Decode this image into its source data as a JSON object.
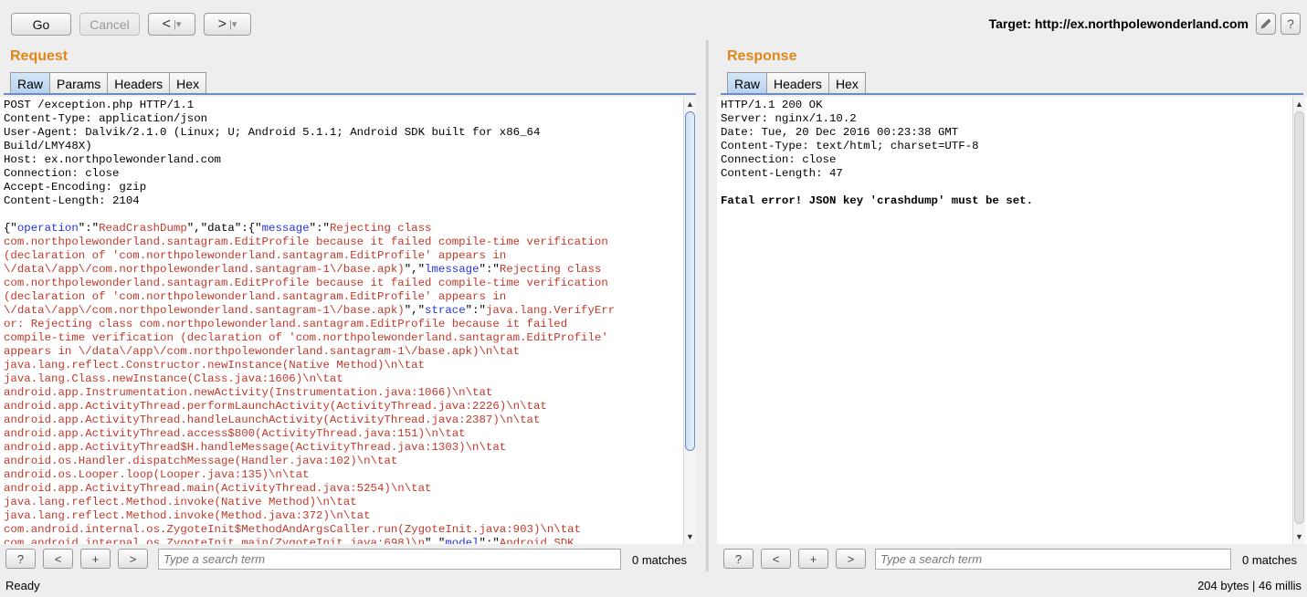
{
  "toolbar": {
    "go_label": "Go",
    "cancel_label": "Cancel",
    "back_glyph": "<",
    "forward_glyph": ">",
    "dropdown_glyph": "▾",
    "target_text": "Target: http://ex.northpolewonderland.com",
    "edit_icon": "pencil-icon",
    "help_glyph": "?"
  },
  "request": {
    "title": "Request",
    "tabs": [
      "Raw",
      "Params",
      "Headers",
      "Hex"
    ],
    "active_tab": "Raw",
    "headers": [
      "POST /exception.php HTTP/1.1",
      "Content-Type: application/json",
      "User-Agent: Dalvik/2.1.0 (Linux; U; Android 5.1.1; Android SDK built for x86_64",
      "Build/LMY48X)",
      "Host: ex.northpolewonderland.com",
      "Connection: close",
      "Accept-Encoding: gzip",
      "Content-Length: 2104"
    ],
    "body": {
      "l1_a": "{\"",
      "l1_key_operation": "operation",
      "l1_b": "\":\"",
      "l1_val_operation": "ReadCrashDump",
      "l1_c": "\",\"data\":{\"",
      "l1_key_message": "message",
      "l1_d": "\":\"",
      "l1_val": "Rejecting class",
      "l2": "com.northpolewonderland.santagram.EditProfile because it failed compile-time verification",
      "l3": "(declaration of 'com.northpolewonderland.santagram.EditProfile' appears in",
      "l4_val": "\\/data\\/app\\/com.northpolewonderland.santagram-1\\/base.apk)",
      "l4_a": "\",\"",
      "l4_key": "lmessage",
      "l4_b": "\":\"",
      "l4_val2": "Rejecting class",
      "l5": "com.northpolewonderland.santagram.EditProfile because it failed compile-time verification",
      "l6": "(declaration of 'com.northpolewonderland.santagram.EditProfile' appears in",
      "l7_val": "\\/data\\/app\\/com.northpolewonderland.santagram-1\\/base.apk)",
      "l7_a": "\",\"",
      "l7_key": "strace",
      "l7_b": "\":\"",
      "l7_val2": "java.lang.VerifyErr",
      "l8": "or: Rejecting class com.northpolewonderland.santagram.EditProfile because it failed",
      "l9": "compile-time verification (declaration of 'com.northpolewonderland.santagram.EditProfile'",
      "l10": "appears in \\/data\\/app\\/com.northpolewonderland.santagram-1\\/base.apk)\\n\\tat",
      "l11": "java.lang.reflect.Constructor.newInstance(Native Method)\\n\\tat",
      "l12": "java.lang.Class.newInstance(Class.java:1606)\\n\\tat",
      "l13": "android.app.Instrumentation.newActivity(Instrumentation.java:1066)\\n\\tat",
      "l14": "android.app.ActivityThread.performLaunchActivity(ActivityThread.java:2226)\\n\\tat",
      "l15": "android.app.ActivityThread.handleLaunchActivity(ActivityThread.java:2387)\\n\\tat",
      "l16": "android.app.ActivityThread.access$800(ActivityThread.java:151)\\n\\tat",
      "l17": "android.app.ActivityThread$H.handleMessage(ActivityThread.java:1303)\\n\\tat",
      "l18": "android.os.Handler.dispatchMessage(Handler.java:102)\\n\\tat",
      "l19": "android.os.Looper.loop(Looper.java:135)\\n\\tat",
      "l20": "android.app.ActivityThread.main(ActivityThread.java:5254)\\n\\tat",
      "l21": "java.lang.reflect.Method.invoke(Native Method)\\n\\tat",
      "l22": "java.lang.reflect.Method.invoke(Method.java:372)\\n\\tat",
      "l23": "com.android.internal.os.ZygoteInit$MethodAndArgsCaller.run(ZygoteInit.java:903)\\n\\tat",
      "l24_a": "com.android.internal.os.ZygoteInit.main(ZygoteInit.java:698)\\n",
      "l24_b": "\",\"",
      "l24_key": "model",
      "l24_c": "\":\"",
      "l24_val": "Android SDK"
    },
    "search": {
      "help": "?",
      "prev": "<",
      "add": "+",
      "next": ">",
      "placeholder": "Type a search term",
      "matches": "0 matches"
    }
  },
  "response": {
    "title": "Response",
    "tabs": [
      "Raw",
      "Headers",
      "Hex"
    ],
    "active_tab": "Raw",
    "headers": [
      "HTTP/1.1 200 OK",
      "Server: nginx/1.10.2",
      "Date: Tue, 20 Dec 2016 00:23:38 GMT",
      "Content-Type: text/html; charset=UTF-8",
      "Connection: close",
      "Content-Length: 47"
    ],
    "body": "Fatal error! JSON key 'crashdump' must be set.",
    "search": {
      "help": "?",
      "prev": "<",
      "add": "+",
      "next": ">",
      "placeholder": "Type a search term",
      "matches": "0 matches"
    }
  },
  "status": {
    "left": "Ready",
    "right": "204 bytes | 46 millis"
  },
  "colors": {
    "accent_title": "#e0861a",
    "json_value": "#c0392b",
    "json_key": "#2233dd"
  }
}
